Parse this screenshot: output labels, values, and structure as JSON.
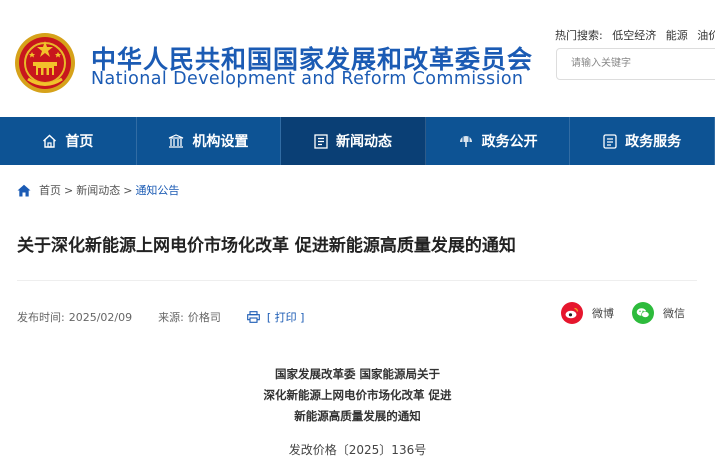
{
  "header": {
    "title_cn": "中华人民共和国国家发展和改革委员会",
    "title_en": "National Development and Reform Commission",
    "hot_search_label": "热门搜索:",
    "hot_search_terms": [
      "低空经济",
      "能源",
      "油价"
    ],
    "search_placeholder": "请输入关键字"
  },
  "nav": {
    "items": [
      {
        "label": "首页",
        "icon": "home-icon"
      },
      {
        "label": "机构设置",
        "icon": "building-icon"
      },
      {
        "label": "新闻动态",
        "icon": "news-icon"
      },
      {
        "label": "政务公开",
        "icon": "open-icon"
      },
      {
        "label": "政务服务",
        "icon": "service-icon"
      }
    ],
    "active_index": 2,
    "color": "#0d5394"
  },
  "breadcrumb": {
    "items": [
      "首页",
      "新闻动态",
      "通知公告"
    ],
    "separator": ">"
  },
  "article": {
    "title": "关于深化新能源上网电价市场化改革 促进新能源高质量发展的通知",
    "date_label": "发布时间:",
    "date": "2025/02/09",
    "source_label": "来源:",
    "source": "价格司",
    "print_label": "[ 打印 ]",
    "share_weibo": "微博",
    "share_wechat": "微信",
    "heading_lines": [
      "国家发展改革委 国家能源局关于",
      "深化新能源上网电价市场化改革 促进",
      "新能源高质量发展的通知"
    ],
    "doc_number": "发改价格〔2025〕136号"
  }
}
